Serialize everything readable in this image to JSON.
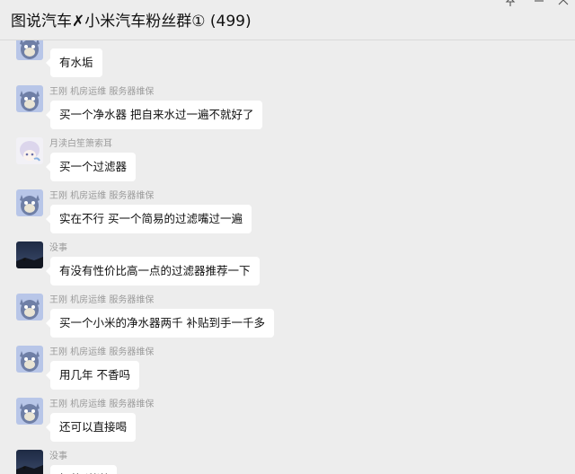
{
  "window": {
    "title": "图说汽车✗小米汽车粉丝群① (499)",
    "pin_icon": "pin-icon",
    "minimize_icon": "minimize-icon",
    "close_icon": "close-icon"
  },
  "messages": [
    {
      "sender": "",
      "text": "有水垢",
      "avatar": "tom-cat-avatar"
    },
    {
      "sender": "王刚 机房运维 服务器维保",
      "text": "买一个净水器  把自来水过一遍不就好了",
      "avatar": "tom-cat-avatar"
    },
    {
      "sender": "月渎白笙箫索耳",
      "text": "买一个过滤器",
      "avatar": "anime-avatar"
    },
    {
      "sender": "王刚 机房运维 服务器维保",
      "text": "实在不行  买一个简易的过滤嘴过一遍",
      "avatar": "tom-cat-avatar"
    },
    {
      "sender": "没事",
      "text": "有没有性价比高一点的过滤器推荐一下",
      "avatar": "night-scene-avatar"
    },
    {
      "sender": "王刚 机房运维 服务器维保",
      "text": "买一个小米的净水器两千  补贴到手一千多",
      "avatar": "tom-cat-avatar"
    },
    {
      "sender": "王刚 机房运维 服务器维保",
      "text": "用几年  不香吗",
      "avatar": "tom-cat-avatar"
    },
    {
      "sender": "王刚 机房运维 服务器维保",
      "text": "还可以直接喝",
      "avatar": "tom-cat-avatar"
    },
    {
      "sender": "没事",
      "text": "好的  谢谢",
      "avatar": "night-scene-avatar"
    }
  ]
}
